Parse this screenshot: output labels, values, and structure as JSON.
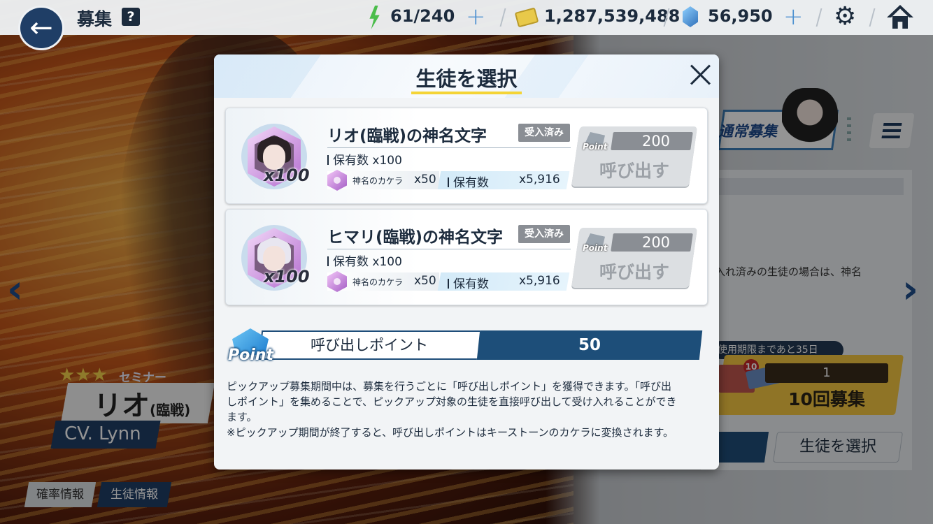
{
  "header": {
    "title": "募集",
    "help_icon": "?",
    "ap": "61/240",
    "credits": "1,287,539,488",
    "pyroxene": "56,950",
    "back_icon": "←",
    "plus_icon": "+",
    "gear_icon": "⚙"
  },
  "background": {
    "tab_label": "通常募集",
    "notice_fragment": "入れ済みの生徒の場合は、神名",
    "expire_text": "使用期限まであと35日",
    "ticket_count": "1",
    "ten_pull_label": "10回募集",
    "ticket_badge": "10",
    "select_student_label": "生徒を選択"
  },
  "character": {
    "stars": "★★★",
    "role": "セミナー",
    "name": "リオ",
    "name_suffix": "(臨戦)",
    "cv": "CV. Lynn"
  },
  "bottom_tabs": {
    "rate_info": "確率情報",
    "student_info": "生徒情報"
  },
  "nav": {
    "left": "‹",
    "right": "›"
  },
  "modal": {
    "title": "生徒を選択",
    "items": [
      {
        "name": "リオ(臨戦)の神名文字",
        "badge": "受入済み",
        "owned": "保有数 x100",
        "emblem_qty": "x100",
        "eleph_label": "神名のカケラ",
        "eleph_x": "x50",
        "hold_label": "保有数",
        "hold_val": "x5,916",
        "cost": "200",
        "point_label": "Point",
        "call_label": "呼び出す"
      },
      {
        "name": "ヒマリ(臨戦)の神名文字",
        "badge": "受入済み",
        "owned": "保有数 x100",
        "emblem_qty": "x100",
        "eleph_label": "神名のカケラ",
        "eleph_x": "x50",
        "hold_label": "保有数",
        "hold_val": "x5,916",
        "cost": "200",
        "point_label": "Point",
        "call_label": "呼び出す"
      }
    ],
    "points": {
      "icon_label": "Point",
      "label": "呼び出しポイント",
      "value": "50"
    },
    "description": [
      "ピックアップ募集期間中は、募集を行うごとに「呼び出しポイント」を獲得できます。「呼び出",
      "しポイント」を集めることで、ピックアップ対象の生徒を直接呼び出して受け入れることができ",
      "ます。",
      "※ピックアップ期間が終了すると、呼び出しポイントはキーストーンのカケラに変換されます。"
    ]
  }
}
